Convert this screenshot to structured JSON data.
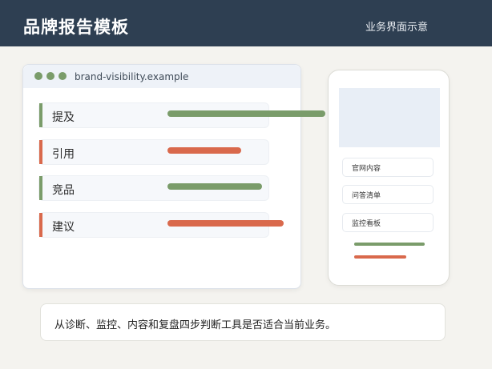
{
  "header": {
    "title": "品牌报告模板",
    "note": "业务界面示意",
    "background": "#2e3f52"
  },
  "browser": {
    "url": "brand-visibility.example",
    "rows": [
      {
        "label": "提及",
        "color": "#7a9c6a"
      },
      {
        "label": "引用",
        "color": "#d9694c"
      },
      {
        "label": "竞品",
        "color": "#7a9c6a"
      },
      {
        "label": "建议",
        "color": "#d9694c"
      }
    ]
  },
  "phone": {
    "items": [
      {
        "label": "官网内容"
      },
      {
        "label": "问答清单"
      },
      {
        "label": "监控看板"
      }
    ]
  },
  "description": {
    "text": "从诊断、监控、内容和复盘四步判断工具是否适合当前业务。"
  },
  "colors": {
    "green": "#7a9c6a",
    "coral": "#d9694c",
    "background": "#f4f3ef"
  }
}
